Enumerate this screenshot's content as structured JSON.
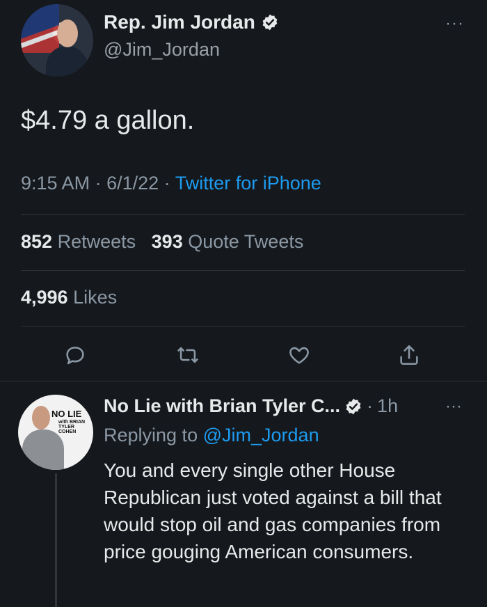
{
  "main_tweet": {
    "author_name": "Rep. Jim Jordan",
    "author_handle": "@Jim_Jordan",
    "more_label": "···",
    "text": "$4.79 a gallon.",
    "time": "9:15 AM",
    "date": "6/1/22",
    "source": "Twitter for iPhone",
    "retweets_count": "852",
    "retweets_label": "Retweets",
    "quotes_count": "393",
    "quotes_label": "Quote Tweets",
    "likes_count": "4,996",
    "likes_label": "Likes"
  },
  "reply_tweet": {
    "author_name": "No Lie with Brian Tyler C...",
    "time": "1h",
    "more_label": "···",
    "replying_prefix": "Replying to",
    "replying_handle": "@Jim_Jordan",
    "text": "You and every single other House Republican just voted against a bill that would stop oil and gas companies from price gouging American consumers.",
    "avatar_text": "NO LIE",
    "avatar_subtext": "with BRIAN TYLER COHEN"
  },
  "colors": {
    "background": "#15181c",
    "text": "#e7e9ea",
    "muted": "#8b98a5",
    "accent": "#1d9bf0"
  },
  "icons": [
    "verified-badge-icon",
    "reply-icon",
    "retweet-icon",
    "like-icon",
    "share-icon",
    "more-icon"
  ]
}
